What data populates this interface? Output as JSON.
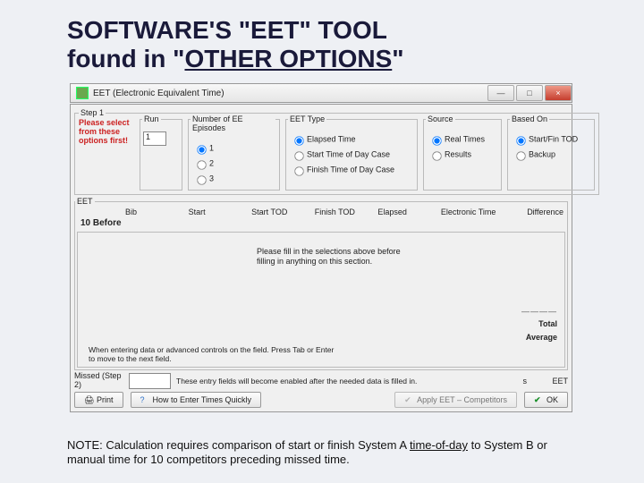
{
  "slide": {
    "title_line1": "SOFTWARE'S \"EET\" TOOL",
    "title_line2_a": "found in \"",
    "title_line2_u": "OTHER OPTIONS",
    "title_line2_b": "\"",
    "note_a": "NOTE: Calculation requires comparison of start or finish System A ",
    "note_u": "time-of-day",
    "note_b": " to System B or manual time for 10 competitors preceding missed time."
  },
  "window": {
    "title": "EET (Electronic Equivalent Time)",
    "min": "—",
    "max": "□",
    "close": "×"
  },
  "step1": {
    "legend": "Step 1",
    "warn": "Please select from these options first!",
    "run_label": "Run",
    "run_value": "1",
    "episodes_label": "Number of EE Episodes",
    "episodes": {
      "o1": "1",
      "o2": "2",
      "o3": "3"
    },
    "type_label": "EET Type",
    "type": {
      "o1": "Elapsed Time",
      "o2": "Start Time of Day Case",
      "o3": "Finish Time of Day Case"
    },
    "source_label": "Source",
    "source": {
      "o1": "Real Times",
      "o2": "Results"
    },
    "baseon_label": "Based On",
    "baseon": {
      "o1": "Start/Fin TOD",
      "o2": "Backup"
    }
  },
  "eet": {
    "legend": "EET",
    "cols": {
      "bib": "Bib",
      "start": "Start",
      "start_tod": "Start TOD",
      "finish_tod": "Finish TOD",
      "elapsed": "Elapsed",
      "etime": "Electronic Time",
      "diff": "Difference"
    },
    "ten": "10 Before",
    "fill": "Please fill in the selections above before filling in anything on this section.",
    "hint": "When entering data or advanced controls on the field. Press Tab or Enter to move to the next field.",
    "total": "Total",
    "avg": "Average",
    "diff_dashes": "————"
  },
  "missed": {
    "label": "Missed (Step 2)",
    "note": "These entry fields will become enabled after the needed data is filled in.",
    "col_s": "s",
    "col_eet": "EET"
  },
  "buttons": {
    "print": "Print",
    "howto": "How to Enter Times Quickly",
    "apply": "Apply EET – Competitors",
    "ok": "OK"
  }
}
